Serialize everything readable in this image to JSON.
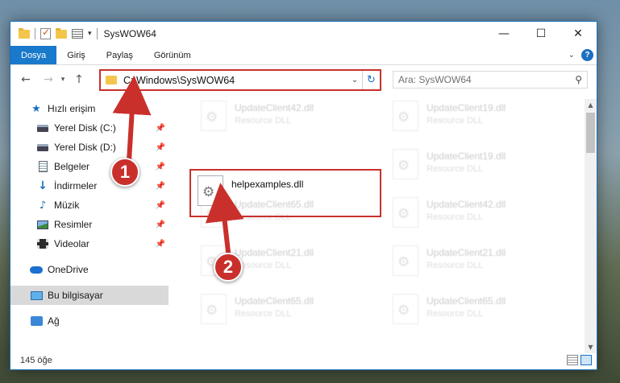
{
  "window": {
    "title": "SysWOW64",
    "controls": {
      "minimize": "—",
      "maximize": "☐",
      "close": "✕"
    }
  },
  "ribbon": {
    "tabs": [
      {
        "label": "Dosya",
        "active": true
      },
      {
        "label": "Giriş"
      },
      {
        "label": "Paylaş"
      },
      {
        "label": "Görünüm"
      }
    ],
    "help": "?"
  },
  "navbar": {
    "back": "←",
    "forward": "→",
    "recent": "▾",
    "up": "↑",
    "address": "C:\\Windows\\SysWOW64",
    "search_placeholder": "Ara: SysWOW64"
  },
  "sidebar": {
    "items": [
      {
        "label": "Hızlı erişim",
        "icon": "star-icon",
        "pinned": false
      },
      {
        "label": "Yerel Disk (C:)",
        "icon": "disk-icon",
        "pinned": true
      },
      {
        "label": "Yerel Disk (D:)",
        "icon": "disk-icon",
        "pinned": true
      },
      {
        "label": "Belgeler",
        "icon": "documents-icon",
        "pinned": true
      },
      {
        "label": "İndirmeler",
        "icon": "downloads-icon",
        "pinned": true
      },
      {
        "label": "Müzik",
        "icon": "music-icon",
        "pinned": true
      },
      {
        "label": "Resimler",
        "icon": "pictures-icon",
        "pinned": true
      },
      {
        "label": "Videolar",
        "icon": "videos-icon",
        "pinned": true
      },
      {
        "label": "OneDrive",
        "icon": "cloud-icon",
        "pinned": false
      },
      {
        "label": "Bu bilgisayar",
        "icon": "computer-icon",
        "pinned": false,
        "selected": true
      },
      {
        "label": "Ağ",
        "icon": "network-icon",
        "pinned": false
      }
    ],
    "pin_glyph": "📌"
  },
  "files": {
    "main": {
      "name": "helpexamples.dll"
    },
    "background": [
      {
        "name": "UpdateClient42.dll",
        "type": "Resource DLL"
      },
      {
        "name": "UpdateClient19.dll",
        "type": "Resource DLL"
      },
      {
        "name": "UpdateClient19.dll",
        "type": "Resource DLL"
      },
      {
        "name": "UpdateClient65.dll",
        "type": "Resource DLL"
      },
      {
        "name": "UpdateClient42.dll",
        "type": "Resource DLL"
      },
      {
        "name": "UpdateClient21.dll",
        "type": "Resource DLL"
      },
      {
        "name": "UpdateClient21.dll",
        "type": "Resource DLL"
      },
      {
        "name": "UpdateClient65.dll",
        "type": "Resource DLL"
      },
      {
        "name": "UpdateClient65.dll",
        "type": "Resource DLL"
      }
    ]
  },
  "status": {
    "count": "145 öğe"
  },
  "callouts": [
    "1",
    "2"
  ],
  "colors": {
    "accent": "#1979ca",
    "highlight": "#c9302c",
    "folder": "#f3c64b"
  }
}
